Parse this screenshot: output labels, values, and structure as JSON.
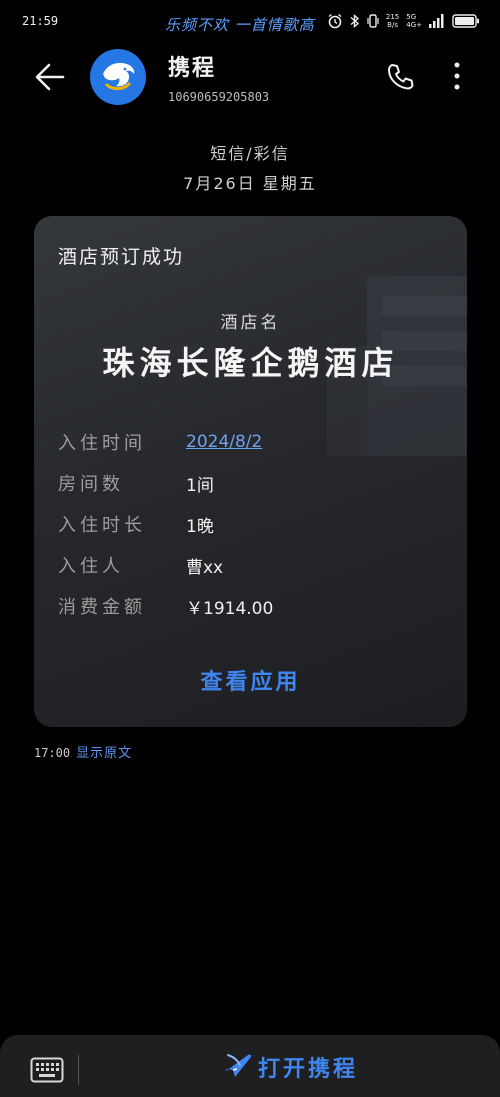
{
  "status_bar": {
    "time": "21:59",
    "notice": "乐频不欢 一首情歌高",
    "net_speed_top": "215",
    "net_speed_bottom": "B/s",
    "sig_top": "5G",
    "sig_bottom": "4G+",
    "icons": [
      "alarm-icon",
      "bluetooth-icon",
      "vibrate-icon",
      "signal-icon",
      "battery-icon"
    ]
  },
  "header": {
    "sender_name": "携程",
    "sender_number": "10690659205803",
    "icons": [
      "back-arrow-icon",
      "dolphin-logo-icon",
      "phone-icon",
      "more-vertical-icon"
    ]
  },
  "message_meta": {
    "type": "短信/彩信",
    "date": "7月26日 星期五"
  },
  "card": {
    "title": "酒店预订成功",
    "hotel_label": "酒店名",
    "hotel_name": "珠海长隆企鹅酒店",
    "rows": [
      {
        "label": "入住时间",
        "value": "2024/8/2"
      },
      {
        "label": "房间数",
        "value": "1间"
      },
      {
        "label": "入住时长",
        "value": "1晚"
      },
      {
        "label": "入住人",
        "value": "曹xx"
      },
      {
        "label": "消费金额",
        "value": "￥1914.00"
      }
    ],
    "action": "查看应用"
  },
  "footer": {
    "time": "17:00",
    "show_original": "显示原文"
  },
  "bottom_bar": {
    "open_app": "打开携程",
    "icons": [
      "keyboard-icon",
      "plane-icon"
    ]
  },
  "colors": {
    "accent": "#3f86f0",
    "background": "#000000",
    "card": "#2a2c30",
    "avatar": "#2577e3"
  }
}
